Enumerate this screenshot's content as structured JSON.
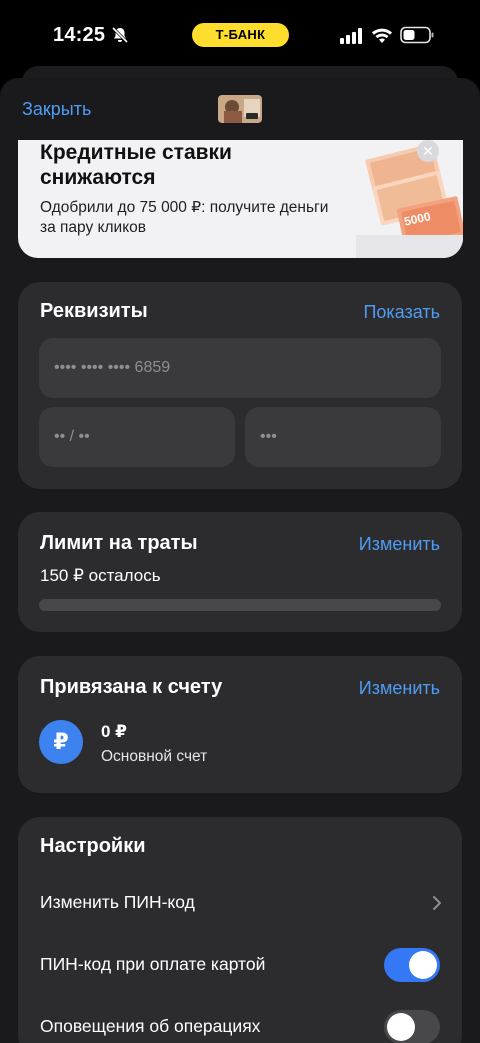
{
  "status_bar": {
    "time": "14:25",
    "carrier_pill": "Т-БАНК"
  },
  "nav": {
    "close_label": "Закрыть"
  },
  "promo": {
    "title": "Кредитные ставки снижаются",
    "subtitle": "Одобрили до 75 000 ₽: получите деньги за пару кликов",
    "banknote_value": "5000"
  },
  "requisites": {
    "title": "Реквизиты",
    "show_label": "Показать",
    "card_number": "•••• •••• •••• 6859",
    "expiry": "•• / ••",
    "cvc": "•••"
  },
  "limit": {
    "title": "Лимит на траты",
    "change_label": "Изменить",
    "remaining_text": "150 ₽ осталось",
    "progress_used_fraction": 0
  },
  "account": {
    "title": "Привязана к счету",
    "change_label": "Изменить",
    "currency_symbol": "₽",
    "balance": "0 ₽",
    "account_name": "Основной счет"
  },
  "settings": {
    "title": "Настройки",
    "items": [
      {
        "label": "Изменить ПИН-код",
        "control": "chevron"
      },
      {
        "label": "ПИН-код при оплате картой",
        "control": "toggle",
        "on": true
      },
      {
        "label": "Оповещения об операциях",
        "control": "toggle",
        "on": false
      }
    ]
  },
  "colors": {
    "accent_link": "#4f9cf5",
    "toggle_on": "#3478f6",
    "brand_yellow": "#ffdd2d"
  }
}
